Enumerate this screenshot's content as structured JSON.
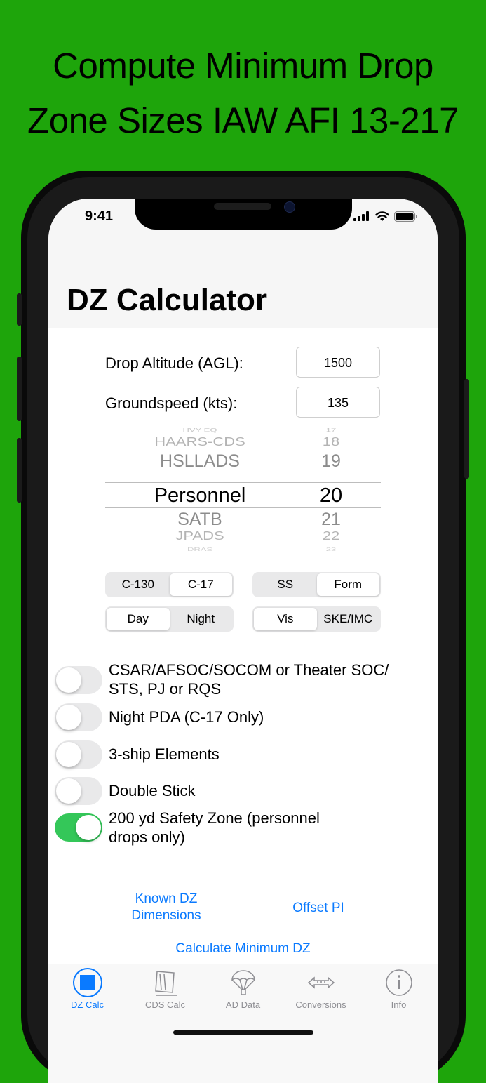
{
  "headline": [
    "Compute Minimum Drop",
    "Zone Sizes IAW AFI 13-217"
  ],
  "status": {
    "time": "9:41"
  },
  "nav": {
    "title": "DZ Calculator"
  },
  "fields": {
    "altitude": {
      "label": "Drop Altitude (AGL):",
      "value": "1500"
    },
    "groundspeed": {
      "label": "Groundspeed (kts):",
      "value": "135"
    }
  },
  "picker": {
    "rows": [
      {
        "name": "HVY EQ",
        "num": "17"
      },
      {
        "name": "HAARS-CDS",
        "num": "18"
      },
      {
        "name": "HSLLADS",
        "num": "19"
      },
      {
        "name": "Personnel",
        "num": "20"
      },
      {
        "name": "SATB",
        "num": "21"
      },
      {
        "name": "JPADS",
        "num": "22"
      },
      {
        "name": "DRAS",
        "num": "23"
      }
    ],
    "selected_index": 3
  },
  "segments": {
    "aircraft": {
      "options": [
        "C-130",
        "C-17"
      ],
      "selected": 1
    },
    "formation": {
      "options": [
        "SS",
        "Form"
      ],
      "selected": 1
    },
    "time": {
      "options": [
        "Day",
        "Night"
      ],
      "selected": 0
    },
    "weather": {
      "options": [
        "Vis",
        "SKE/IMC"
      ],
      "selected": 0
    }
  },
  "toggles": [
    {
      "label_lines": [
        "CSAR/AFSOC/SOCOM or Theater SOC/",
        "STS, PJ or RQS"
      ],
      "on": false
    },
    {
      "label_lines": [
        "Night PDA (C-17 Only)"
      ],
      "on": false
    },
    {
      "label_lines": [
        "3-ship Elements"
      ],
      "on": false
    },
    {
      "label_lines": [
        "Double Stick"
      ],
      "on": false
    },
    {
      "label_lines": [
        "200 yd Safety Zone (personnel",
        "drops only)"
      ],
      "on": true
    }
  ],
  "links": {
    "known_dz": [
      "Known DZ",
      "Dimensions"
    ],
    "offset_pi": "Offset PI",
    "calculate": "Calculate Minimum DZ"
  },
  "tabs": [
    {
      "label": "DZ Calc",
      "icon": "dz-calc-icon",
      "active": true
    },
    {
      "label": "CDS Calc",
      "icon": "cds-calc-icon",
      "active": false
    },
    {
      "label": "AD Data",
      "icon": "parachute-icon",
      "active": false
    },
    {
      "label": "Conversions",
      "icon": "conversions-icon",
      "active": false
    },
    {
      "label": "Info",
      "icon": "info-icon",
      "active": false
    }
  ],
  "colors": {
    "background": "#1ea50b",
    "accent": "#0a7aff",
    "switch_on": "#34c759"
  }
}
